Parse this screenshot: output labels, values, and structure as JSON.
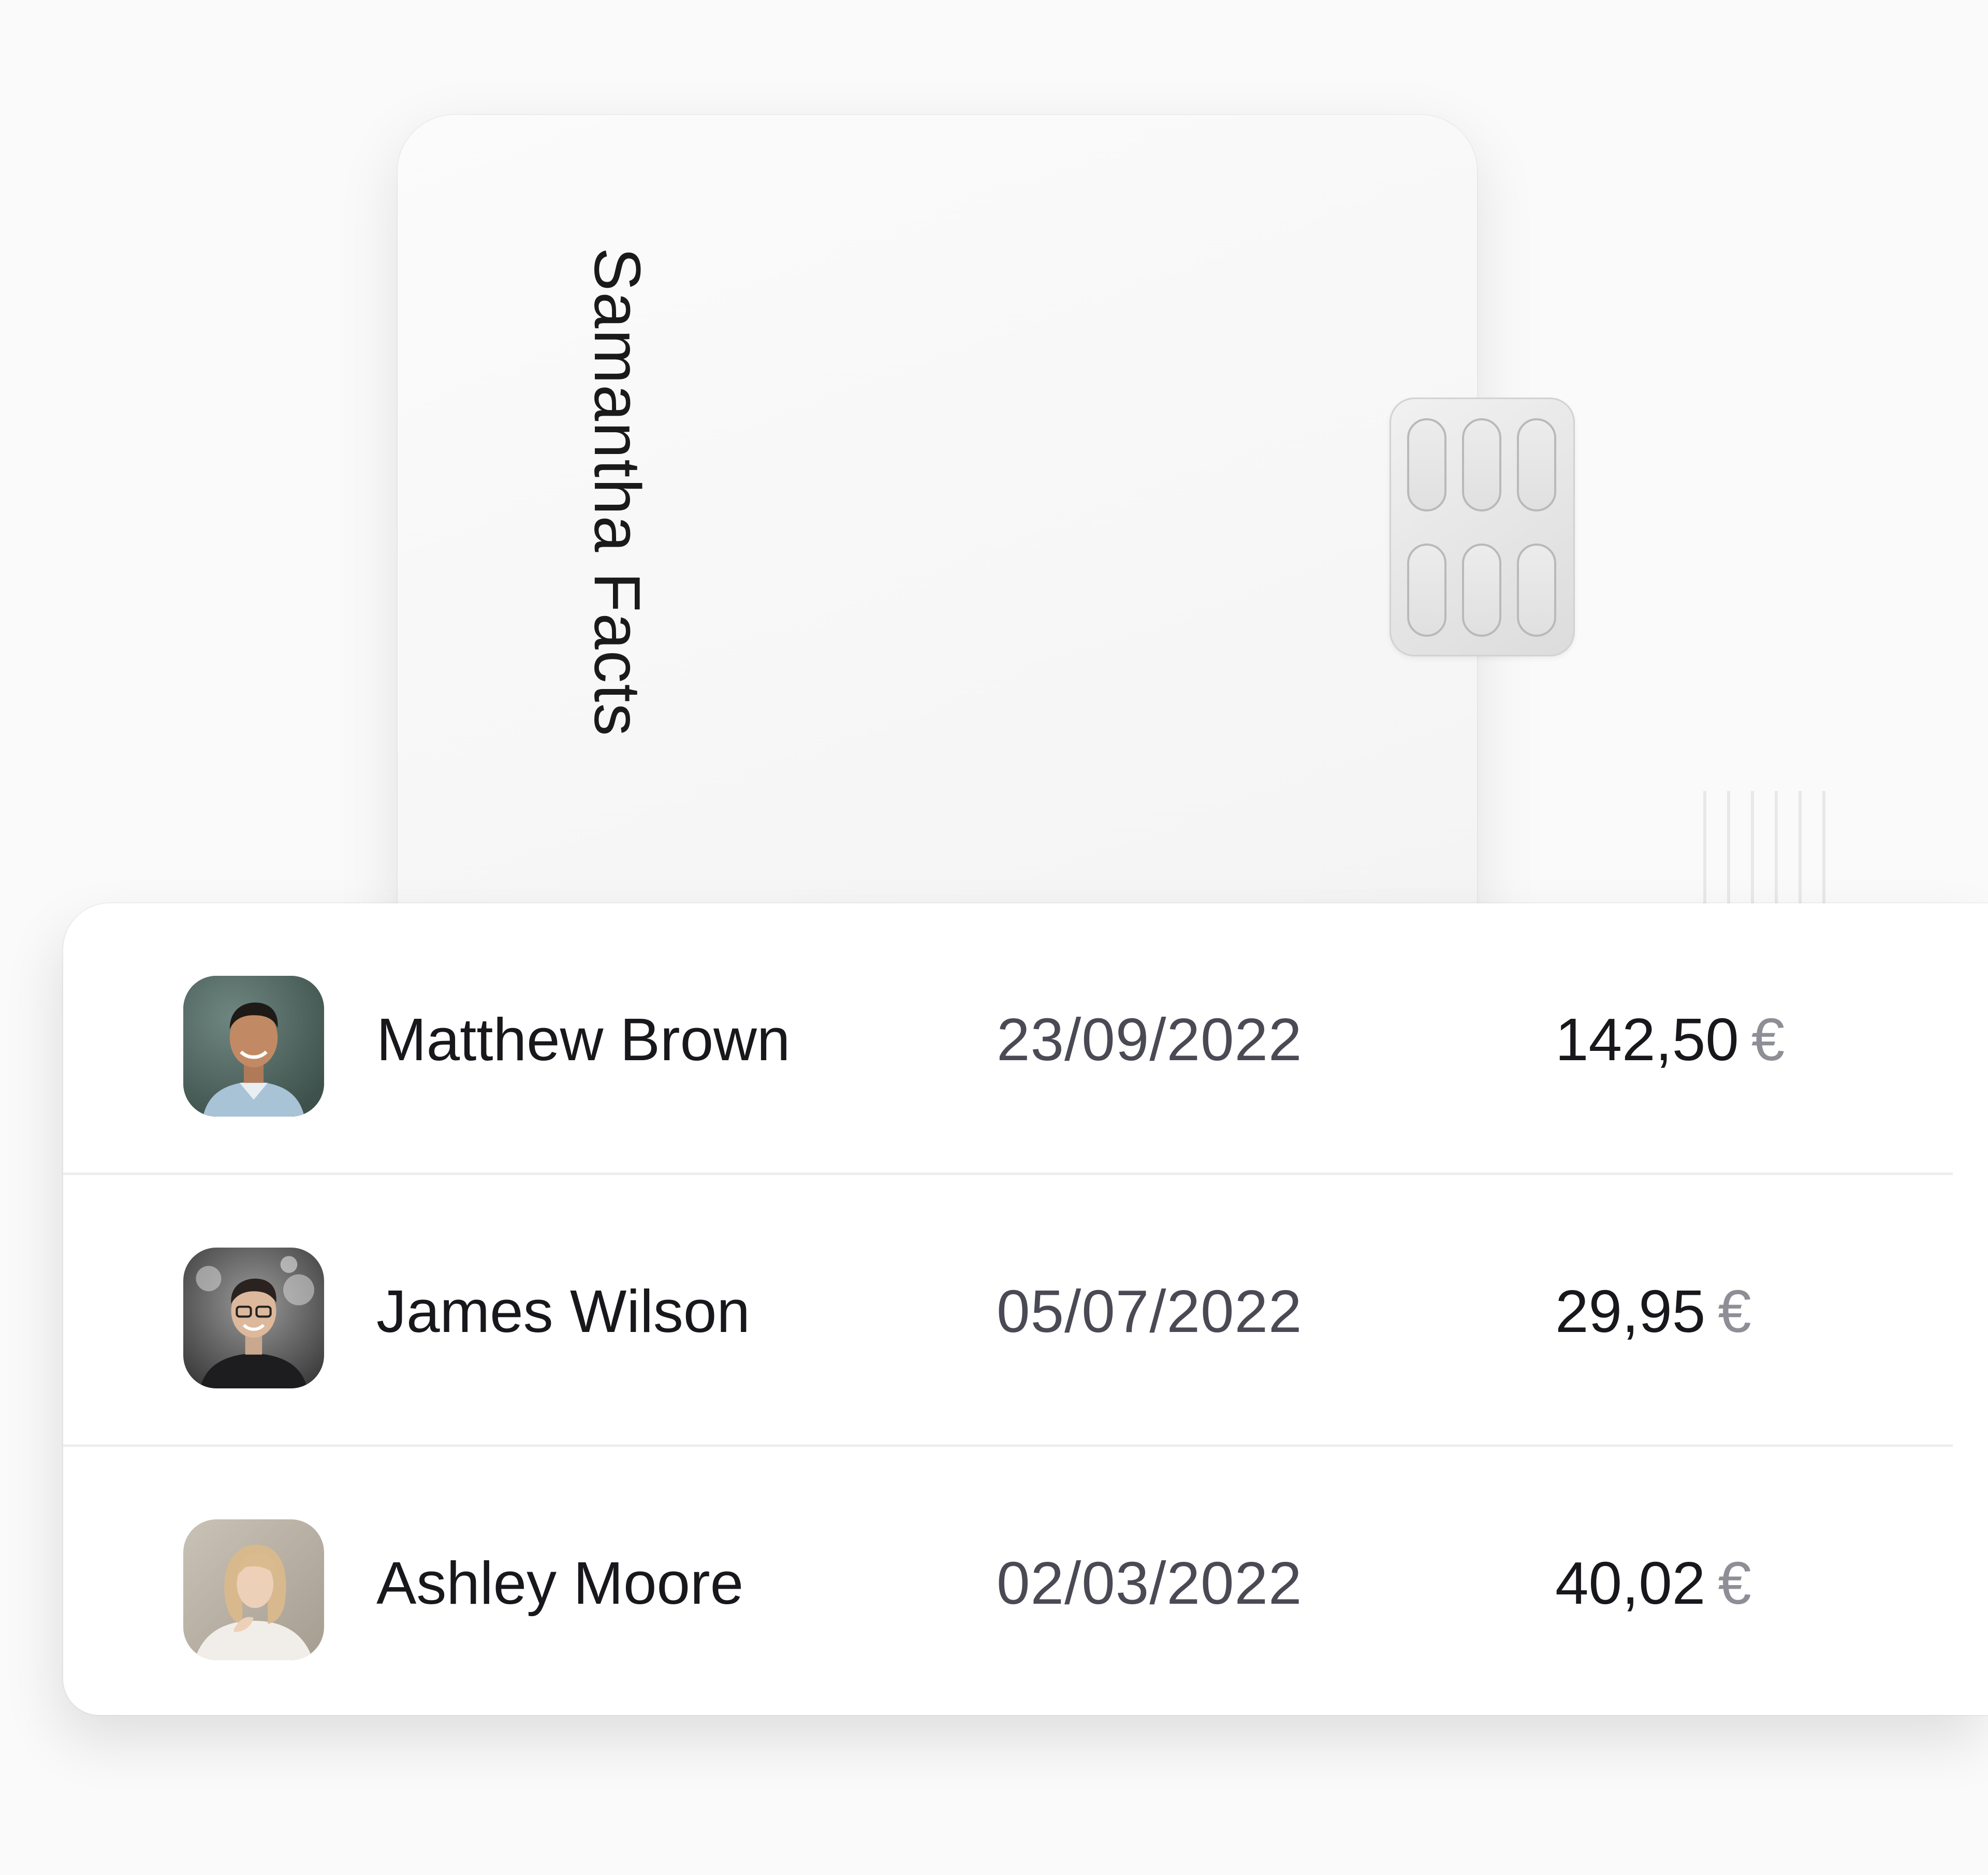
{
  "card": {
    "holder_name": "Samantha Facts"
  },
  "transactions": [
    {
      "name": "Matthew Brown",
      "date": "23/09/2022",
      "amount": "142,50",
      "currency": "€"
    },
    {
      "name": "James Wilson",
      "date": "05/07/2022",
      "amount": "29,95",
      "currency": "€"
    },
    {
      "name": "Ashley Moore",
      "date": "02/03/2022",
      "amount": "40,02",
      "currency": "€"
    }
  ],
  "colors": {
    "background": "#fafafa",
    "card": "#f8f8f8",
    "panel": "#ffffff",
    "text_primary": "#17171c",
    "text_secondary": "#4a4a55",
    "currency": "#8e8e96",
    "divider": "#eeeef0"
  }
}
